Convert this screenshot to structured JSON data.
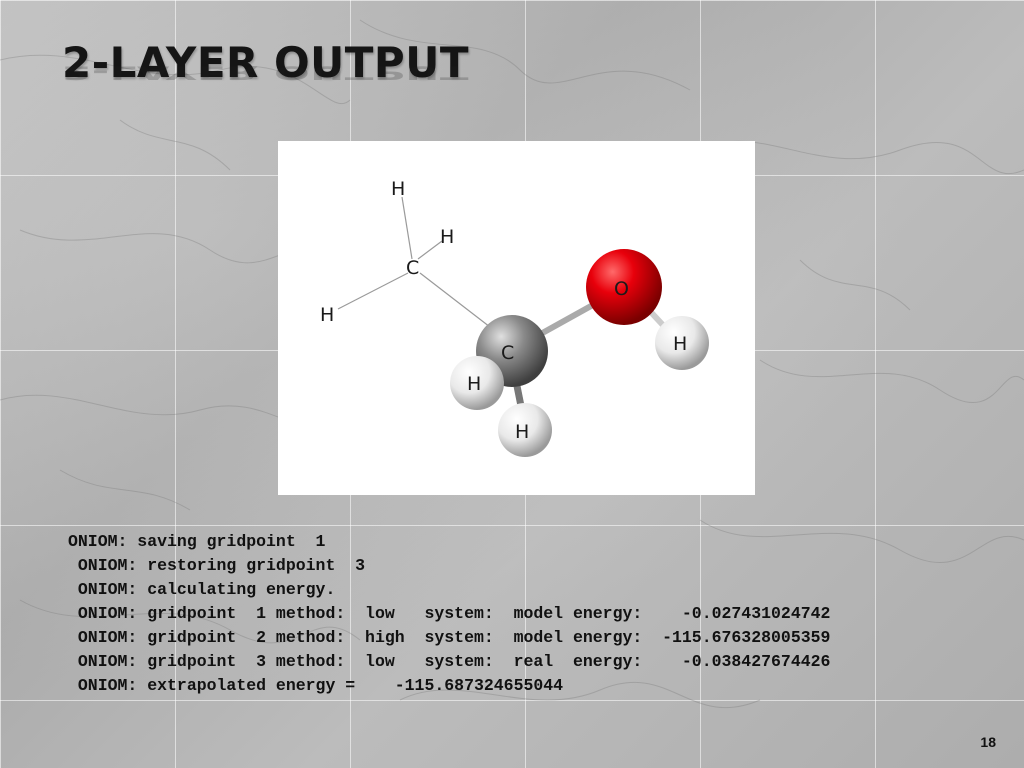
{
  "slide": {
    "title": "2-LAYER OUTPUT",
    "page_number": "18"
  },
  "molecule": {
    "atoms": [
      {
        "element": "H",
        "label": "H"
      },
      {
        "element": "H",
        "label": "H"
      },
      {
        "element": "C",
        "label": "C"
      },
      {
        "element": "H",
        "label": "H"
      },
      {
        "element": "C",
        "label": "C"
      },
      {
        "element": "O",
        "label": "O"
      },
      {
        "element": "H",
        "label": "H"
      },
      {
        "element": "H",
        "label": "H"
      },
      {
        "element": "H",
        "label": "H"
      }
    ],
    "colors": {
      "oxygen": "#e8000b",
      "carbon": "#8a8a8a",
      "hydrogen": "#e9e9e9"
    }
  },
  "output": {
    "lines": [
      "ONIOM: saving gridpoint  1",
      " ONIOM: restoring gridpoint  3",
      " ONIOM: calculating energy.",
      " ONIOM: gridpoint  1 method:  low   system:  model energy:    -0.027431024742",
      " ONIOM: gridpoint  2 method:  high  system:  model energy:  -115.676328005359",
      " ONIOM: gridpoint  3 method:  low   system:  real  energy:    -0.038427674426",
      " ONIOM: extrapolated energy =    -115.687324655044"
    ]
  }
}
